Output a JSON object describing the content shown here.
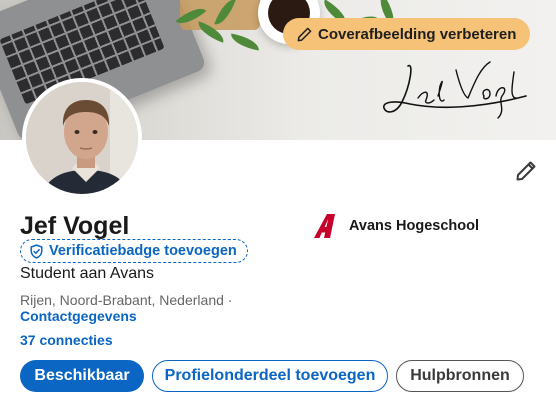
{
  "cover": {
    "button_label": "Coverafbeelding verbeteren",
    "signature_text": "Jef Vogel"
  },
  "profile": {
    "name": "Jef Vogel",
    "verification_label": "Verificatiebadge toevoegen",
    "headline": "Student aan Avans",
    "location": "Rijen, Noord-Brabant, Nederland ·",
    "contact_label": "Contactgegevens",
    "connections": "37 connecties",
    "school_name": "Avans Hogeschool"
  },
  "actions": {
    "available": "Beschikbaar",
    "add_section": "Profielonderdeel toevoegen",
    "resources": "Hulpbronnen"
  },
  "colors": {
    "linkedin_blue": "#0a66c2",
    "cover_button": "#f5c277",
    "avans_red": "#c6002a"
  },
  "icons": {
    "cover_button": "pencil-icon",
    "verify": "shield-check-icon",
    "edit": "pencil-icon",
    "school_logo": "avans-logo"
  }
}
